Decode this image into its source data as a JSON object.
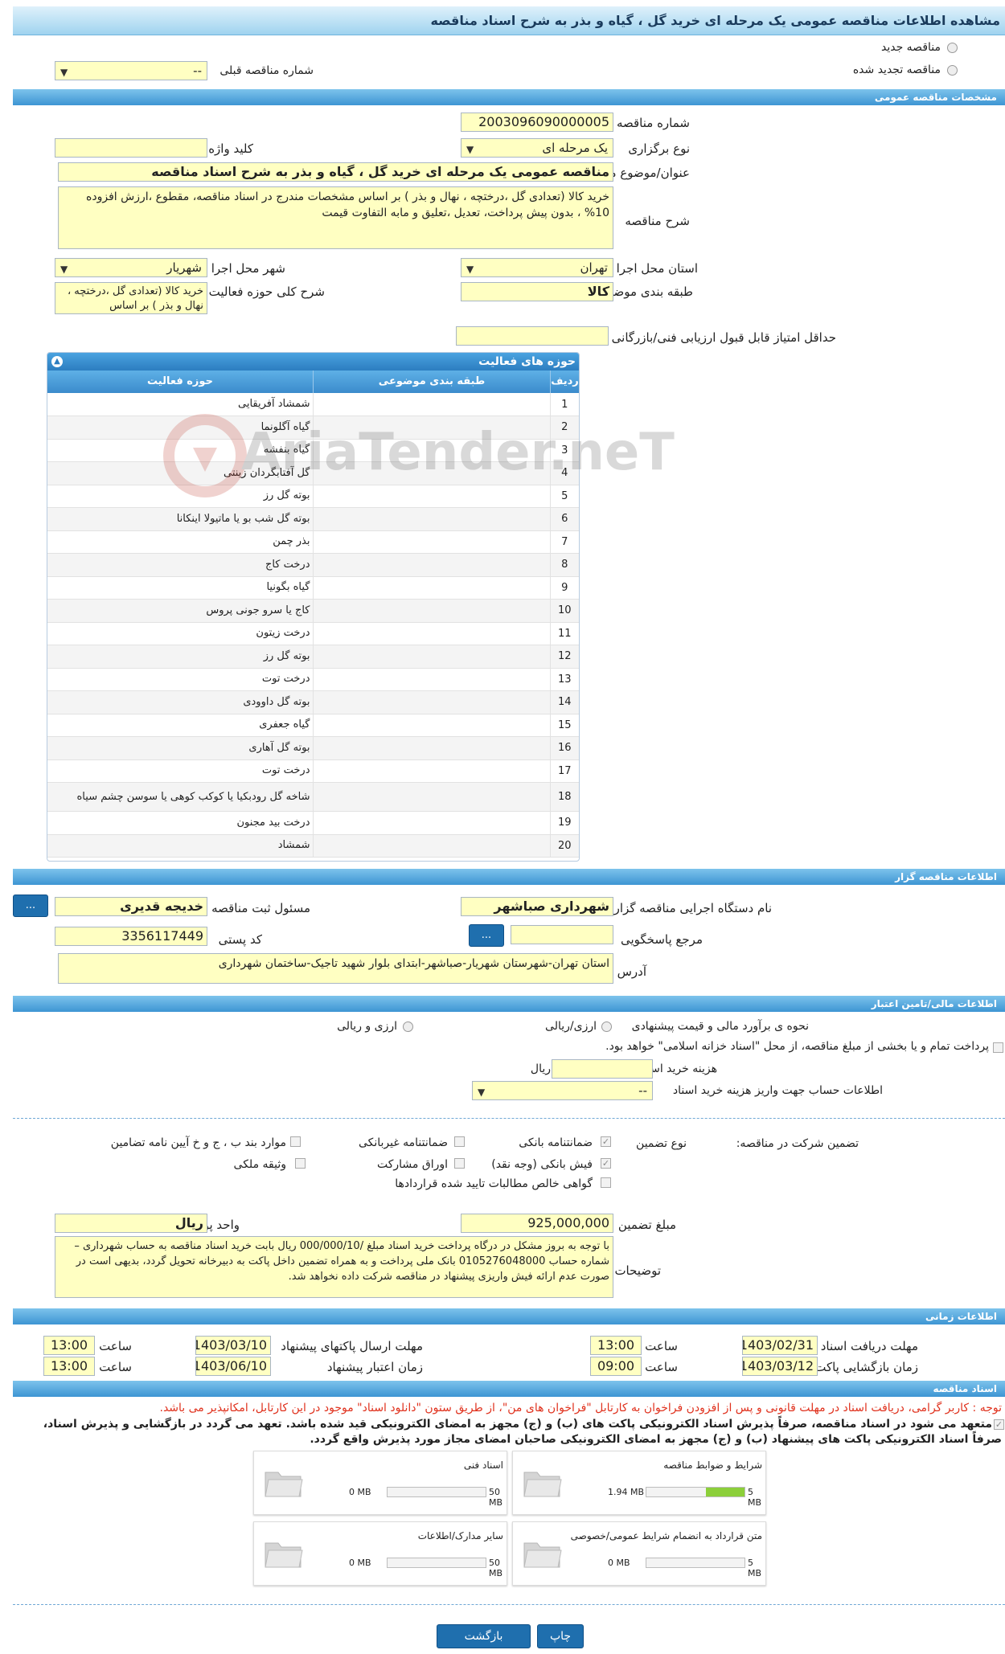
{
  "title": "مشاهده اطلاعات مناقصه عمومی یک مرحله ای خرید گل ، گیاه و بذر به شرح اسناد مناقصه",
  "tender_type": {
    "new": "مناقصه جدید",
    "renewed": "مناقصه تجدید شده",
    "prev_label": "شماره مناقصه قبلی",
    "prev_value": "--"
  },
  "general": {
    "section": "مشخصات مناقصه عمومی",
    "number_label": "شماره مناقصه",
    "number": "2003096090000005",
    "holding_label": "نوع برگزاری",
    "holding": "یک مرحله ای",
    "keyword_label": "کلید واژه",
    "keyword": "",
    "subject_label": "عنوان/موضوع مناقصه",
    "subject": "مناقصه عمومی یک مرحله ای خرید گل ، گیاه و بذر به شرح اسناد مناقصه",
    "desc_label": "شرح مناقصه",
    "desc": "خرید کالا (تعدادی گل ،درختچه ، نهال و بذر ) بر اساس مشخصات مندرج در اسناد مناقصه، مقطوع ،ارزش افزوده 10% ، بدون پیش پرداخت، تعدیل ،تعلیق و مابه التفاوت قیمت",
    "province_label": "استان محل اجرا",
    "province": "تهران",
    "city_label": "شهر محل اجرا",
    "city": "شهریار",
    "category_label": "طبقه بندی موضوعی",
    "category": "کالا",
    "activity_desc_label": "شرح کلی حوزه فعالیت",
    "activity_desc": "خرید کالا (تعدادی گل ،درختچه ، نهال و بذر ) بر اساس",
    "min_score_label": "حداقل امتیاز قابل قبول ارزیابی فنی/بازرگانی",
    "min_score": ""
  },
  "activities": {
    "title": "حوزه های فعالیت",
    "col_row": "ردیف",
    "col_cat": "طبقه بندی موضوعی",
    "col_field": "حوزه فعالیت",
    "rows": [
      {
        "n": "1",
        "field": "شمشاد آفریقایی"
      },
      {
        "n": "2",
        "field": "گیاه آگلونما"
      },
      {
        "n": "3",
        "field": "گیاه بنفشه"
      },
      {
        "n": "4",
        "field": "گل آفتابگردان زینتی"
      },
      {
        "n": "5",
        "field": "بوته گل رز"
      },
      {
        "n": "6",
        "field": "بوته گل شب بو یا ماتیولا اینکانا"
      },
      {
        "n": "7",
        "field": "بذر چمن"
      },
      {
        "n": "8",
        "field": "درخت کاج"
      },
      {
        "n": "9",
        "field": "گیاه بگونیا"
      },
      {
        "n": "10",
        "field": "کاج یا سرو جونی پروس"
      },
      {
        "n": "11",
        "field": "درخت زیتون"
      },
      {
        "n": "12",
        "field": "بوته گل رز"
      },
      {
        "n": "13",
        "field": "درخت توت"
      },
      {
        "n": "14",
        "field": "بوته گل داوودی"
      },
      {
        "n": "15",
        "field": "گیاه جعفری"
      },
      {
        "n": "16",
        "field": "بوته گل آهاری"
      },
      {
        "n": "17",
        "field": "درخت توت"
      },
      {
        "n": "18",
        "field": "شاخه گل رودبکیا یا کوکب کوهی یا سوسن چشم سیاه"
      },
      {
        "n": "19",
        "field": "درخت بید مجنون"
      },
      {
        "n": "20",
        "field": "شمشاد"
      }
    ]
  },
  "watermark": "AriaTender.neT",
  "organizer": {
    "section": "اطلاعات مناقصه گزار",
    "org_label": "نام دستگاه اجرایی مناقصه گزار",
    "org": "شهرداری صباشهر",
    "resp_label": "مسئول ثبت مناقصه",
    "resp": "خدیجه قدیری",
    "ref_label": "مرجع پاسخگویی",
    "ref": "",
    "postal_label": "کد پستی",
    "postal": "3356117449",
    "address_label": "آدرس",
    "address": "استان تهران-شهرستان شهریار-صباشهر-ابتدای بلوار شهید تاجیک-ساختمان شهرداری",
    "dots": "..."
  },
  "finance": {
    "section": "اطلاعات مالی/تامین اعتبار",
    "method_label": "نحوه ی برآورد مالی و قیمت پیشنهادی",
    "opt1": "ارزی/ریالی",
    "opt2": "ارزی و ریالی",
    "treasury": "پرداخت تمام و یا بخشی از مبلغ مناقصه، از محل \"اسناد خزانه اسلامی\" خواهد بود.",
    "doc_cost_label": "هزینه خرید اسناد",
    "doc_cost_unit": "ریال",
    "doc_cost": "",
    "account_label": "اطلاعات حساب جهت واریز هزینه خرید اسناد",
    "account": "--"
  },
  "guarantee": {
    "label": "تضمین شرکت در مناقصه:",
    "type_label": "نوع تضمین",
    "items": [
      "ضمانتنامه بانکی",
      "ضمانتنامه غیربانکی",
      "موارد بند ب ، ج و خ آیین نامه تضامین",
      "فیش بانکی (وجه نقد)",
      "اوراق مشارکت",
      "وثیقه ملکی",
      "گواهی خالص مطالبات تایید شده قراردادها"
    ],
    "amount_label": "مبلغ تضمین",
    "amount": "925,000,000",
    "currency_label": "واحد پول",
    "currency": "ریال",
    "notes_label": "توضیحات",
    "notes": "با توجه به بروز مشکل در درگاه پرداخت خرید اسناد مبلغ /000/000/10  ریال بابت خرید اسناد مناقصه به حساب شهرداری – شماره حساب 0105276048000   بانک ملی پرداخت و به همراه تضمین داخل پاکت  به دبیرخانه تحویل گردد، بدیهی است در صورت عدم ارائه  فیش واریزی پیشنهاد در مناقصه شرکت داده نخواهد شد."
  },
  "timing": {
    "section": "اطلاعات زمانی",
    "doc_deadline_label": "مهلت دریافت اسناد",
    "doc_deadline": "1403/02/31",
    "doc_time": "13:00",
    "send_label": "مهلت ارسال پاکتهای پیشنهاد",
    "send_date": "1403/03/10",
    "send_time": "13:00",
    "open_label": "زمان بازگشایی پاکت ها",
    "open_date": "1403/03/12",
    "open_time": "09:00",
    "valid_label": "زمان اعتبار پیشنهاد",
    "valid_date": "1403/06/10",
    "valid_time": "13:00",
    "time_label": "ساعت"
  },
  "docs": {
    "section": "اسناد مناقصه",
    "note_red": "توجه : کاربر گرامی، دریافت اسناد در مهلت قانونی و پس از افزودن فراخوان به کارتابل \"فراخوان های من\"، از طریق ستون \"دانلود اسناد\" موجود در این کارتابل، امکانپذیر می باشد.",
    "commit1": "متعهد می شود در اسناد مناقصه، صرفاً پذیرش اسناد الکترونیکی پاکت های (ب) و (ج) مجهز به امضای الکترونیکی قید شده باشد. تعهد می گردد در بازگشایی و پذیرش اسناد،",
    "commit2": "صرفاً اسناد الکترونیکی پاکت های پیشنهاد (ب) و (ج) مجهز به امضای الکترونیکی صاحبان امضای مجاز مورد پذیرش واقع گردد.",
    "tiles": [
      {
        "name": "شرایط و ضوابط مناقصه",
        "used": "1.94 MB",
        "max": "5 MB",
        "fill": 0.39
      },
      {
        "name": "اسناد فنی",
        "used": "0 MB",
        "max": "50 MB",
        "fill": 0
      },
      {
        "name": "متن قرارداد به انضمام شرایط عمومی/خصوصی",
        "used": "0 MB",
        "max": "5 MB",
        "fill": 0
      },
      {
        "name": "سایر مدارک/اطلاعات",
        "used": "0 MB",
        "max": "50 MB",
        "fill": 0
      }
    ]
  },
  "buttons": {
    "print": "چاپ",
    "back": "بازگشت"
  }
}
